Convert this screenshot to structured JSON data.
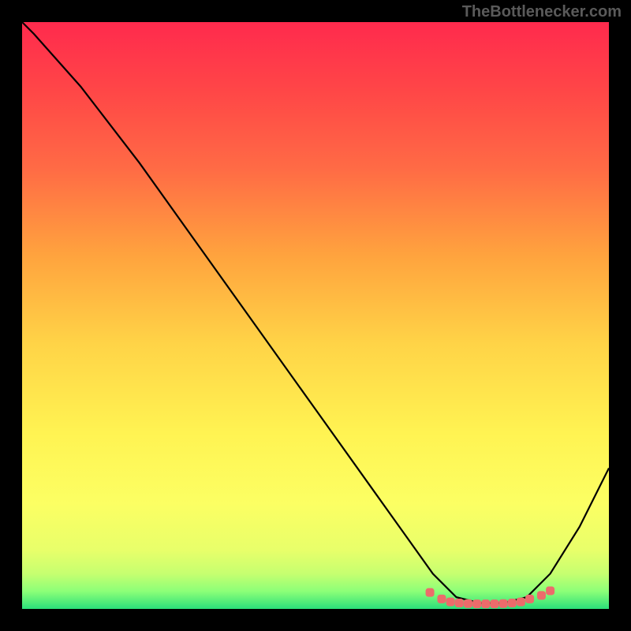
{
  "watermark": "TheBottlenecker.com",
  "chart_data": {
    "type": "line",
    "title": "",
    "xlabel": "",
    "ylabel": "",
    "xlim": [
      0,
      100
    ],
    "ylim": [
      0,
      100
    ],
    "series": [
      {
        "name": "curve",
        "x": [
          0,
          2,
          10,
          20,
          30,
          40,
          50,
          60,
          65,
          70,
          74,
          78,
          82,
          86,
          90,
          95,
          100
        ],
        "y": [
          100,
          98,
          89,
          76,
          62,
          48,
          34,
          20,
          13,
          6,
          2,
          1,
          1,
          2,
          6,
          14,
          24
        ]
      }
    ],
    "markers": {
      "x": [
        69.5,
        71.5,
        73,
        74.5,
        76,
        77.5,
        79,
        80.5,
        82,
        83.5,
        85,
        86.5,
        88.5,
        90
      ],
      "y": [
        2.8,
        1.7,
        1.2,
        1.0,
        0.9,
        0.85,
        0.85,
        0.85,
        0.9,
        1.0,
        1.2,
        1.7,
        2.3,
        3.1
      ]
    },
    "background": {
      "type": "vertical-gradient",
      "stops": [
        {
          "offset": 0.0,
          "color": "#ff2a4d"
        },
        {
          "offset": 0.12,
          "color": "#ff4747"
        },
        {
          "offset": 0.25,
          "color": "#ff6b45"
        },
        {
          "offset": 0.4,
          "color": "#ffa43e"
        },
        {
          "offset": 0.55,
          "color": "#ffd447"
        },
        {
          "offset": 0.7,
          "color": "#fff352"
        },
        {
          "offset": 0.82,
          "color": "#fcff63"
        },
        {
          "offset": 0.9,
          "color": "#e8ff6a"
        },
        {
          "offset": 0.94,
          "color": "#c6ff70"
        },
        {
          "offset": 0.97,
          "color": "#8cff78"
        },
        {
          "offset": 1.0,
          "color": "#2bdf7a"
        }
      ]
    },
    "marker_color": "#ec6b6b",
    "line_color": "#000000"
  }
}
